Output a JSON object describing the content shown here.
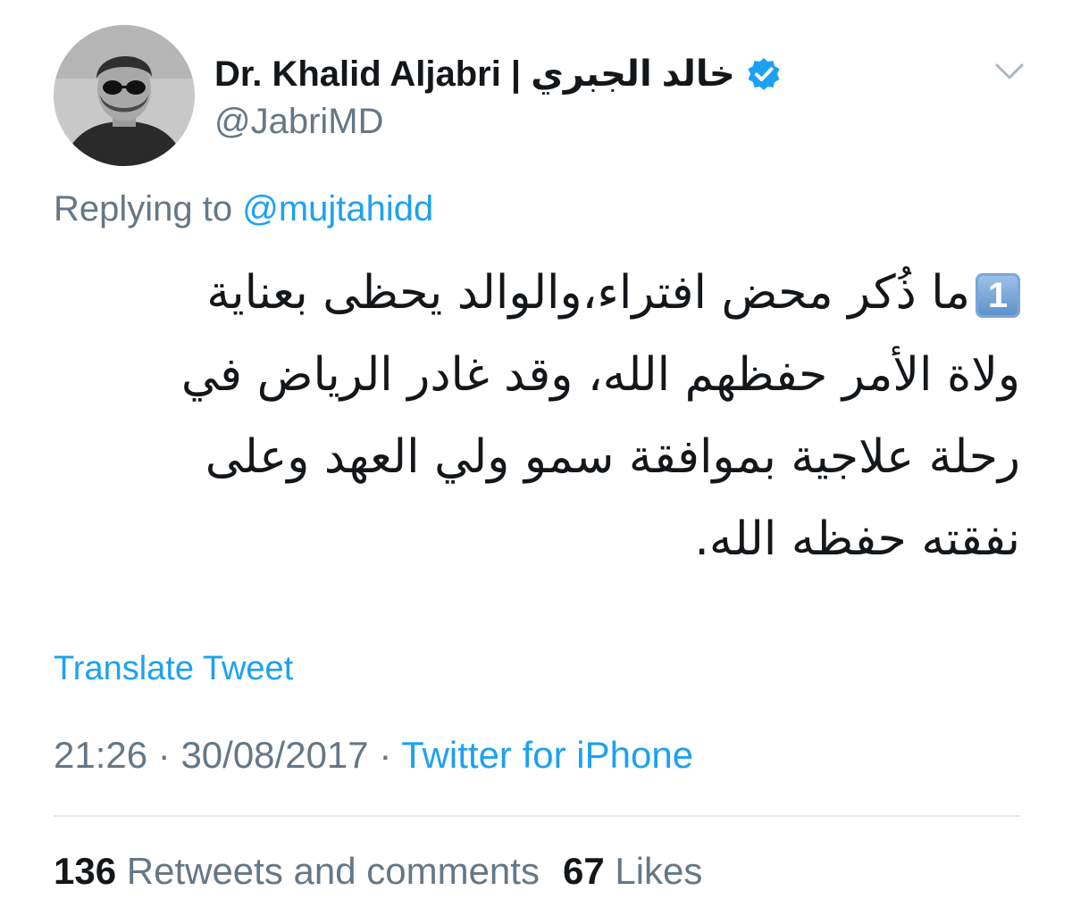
{
  "author": {
    "display_name": "Dr. Khalid Aljabri | خالد الجبري",
    "handle": "@JabriMD",
    "verified": true,
    "verified_icon": "verified-badge-icon",
    "avatar_icon": "profile-photo"
  },
  "menu": {
    "icon": "chevron-down-icon"
  },
  "reply": {
    "prefix": "Replying to",
    "mention": "@mujtahidd"
  },
  "tweet": {
    "number_emoji": "1",
    "lines": [
      "ما ذُكر محض افتراء،والوالد يحظى  بعناية",
      "ولاة الأمر حفظهم الله، وقد غادر الرياض في",
      "رحلة علاجية بموافقة سمو ولي العهد وعلى",
      "نفقته حفظه الله."
    ]
  },
  "translate_label": "Translate Tweet",
  "meta": {
    "time": "21:26",
    "separator1": " · ",
    "date": "30/08/2017",
    "separator2": " · ",
    "source": "Twitter for iPhone"
  },
  "stats": {
    "retweets_count": "136",
    "retweets_label": "Retweets and comments",
    "likes_count": "67",
    "likes_label": "Likes"
  },
  "colors": {
    "link": "#1da1f2",
    "secondary_text": "#657786",
    "primary_text": "#14171a",
    "divider": "#e1e8ed"
  }
}
